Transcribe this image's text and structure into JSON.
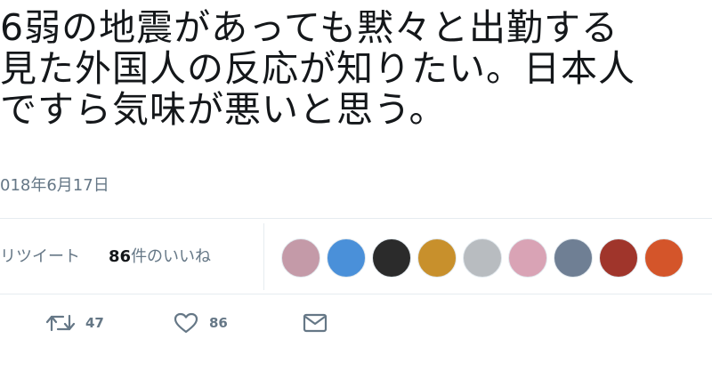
{
  "tweet": {
    "lines": [
      "6弱の地震があっても黙々と出勤する",
      "見た外国人の反応が知りたい。日本人",
      "ですら気味が悪いと思う。"
    ],
    "date": "018年6月17日"
  },
  "stats": {
    "retweets_label": "リツイート",
    "likes_count": "86",
    "likes_label": "件のいいね"
  },
  "avatars": [
    {
      "name": "avatar-1",
      "color": "#c49aa8"
    },
    {
      "name": "avatar-2",
      "color": "#4a90d9"
    },
    {
      "name": "avatar-3",
      "color": "#2b2b2b"
    },
    {
      "name": "avatar-4",
      "color": "#c8902c"
    },
    {
      "name": "avatar-5",
      "color": "#b8bcc0"
    },
    {
      "name": "avatar-6",
      "color": "#d9a3b5"
    },
    {
      "name": "avatar-7",
      "color": "#6f7f94"
    },
    {
      "name": "avatar-8",
      "color": "#a0352b"
    },
    {
      "name": "avatar-9",
      "color": "#d4552a"
    }
  ],
  "actions": {
    "retweet_count": "47",
    "like_count": "86",
    "icons": [
      "retweet-icon",
      "heart-icon",
      "envelope-icon"
    ]
  },
  "colors": {
    "text": "#14171a",
    "muted": "#657786",
    "divider": "#e6ecf0"
  }
}
